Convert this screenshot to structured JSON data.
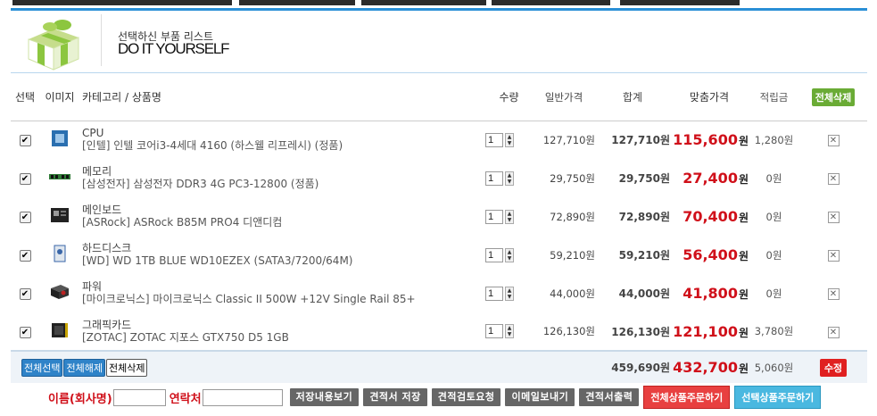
{
  "header": {
    "subtitle": "선택하신 부품 리스트",
    "title": "DO IT YOURSELF"
  },
  "columns": {
    "select": "선택",
    "image": "이미지",
    "category_product": "카테고리 / 상품명",
    "qty": "수량",
    "list_price": "일반가격",
    "sum": "합계",
    "sale_price": "맞춤가격",
    "points": "적립금",
    "delete_all": "전체삭제"
  },
  "currency": "원",
  "items": [
    {
      "checked": true,
      "icon": "cpu-icon",
      "category": "CPU",
      "name": "[인텔] 인텔 코어i3-4세대 4160 (하스웰 리프레시) (정품)",
      "qty": "1",
      "list_price": "127,710원",
      "sum": "127,710원",
      "sale_price": "115,600",
      "points": "1,280원"
    },
    {
      "checked": true,
      "icon": "memory-icon",
      "category": "메모리",
      "name": "[삼성전자] 삼성전자 DDR3 4G PC3-12800 (정품)",
      "qty": "1",
      "list_price": "29,750원",
      "sum": "29,750원",
      "sale_price": "27,400",
      "points": "0원"
    },
    {
      "checked": true,
      "icon": "mainboard-icon",
      "category": "메인보드",
      "name": "[ASRock] ASRock B85M PRO4 디앤디컴",
      "qty": "1",
      "list_price": "72,890원",
      "sum": "72,890원",
      "sale_price": "70,400",
      "points": "0원"
    },
    {
      "checked": true,
      "icon": "hdd-icon",
      "category": "하드디스크",
      "name": "[WD] WD 1TB BLUE WD10EZEX (SATA3/7200/64M)",
      "qty": "1",
      "list_price": "59,210원",
      "sum": "59,210원",
      "sale_price": "56,400",
      "points": "0원"
    },
    {
      "checked": true,
      "icon": "psu-icon",
      "category": "파워",
      "name": "[마이크로닉스] 마이크로닉스 Classic II 500W +12V Single Rail 85+",
      "qty": "1",
      "list_price": "44,000원",
      "sum": "44,000원",
      "sale_price": "41,800",
      "points": "0원"
    },
    {
      "checked": true,
      "icon": "gpu-icon",
      "category": "그래픽카드",
      "name": "[ZOTAC] ZOTAC 지포스 GTX750 D5 1GB",
      "qty": "1",
      "list_price": "126,130원",
      "sum": "126,130원",
      "sale_price": "121,100",
      "points": "3,780원"
    }
  ],
  "footer": {
    "select_all": "전체선택",
    "deselect_all": "전체해제",
    "delete_all": "전체삭제",
    "total_sum": "459,690원",
    "total_sale": "432,700",
    "total_points": "5,060원",
    "modify": "수정"
  },
  "bottom": {
    "name_label": "이름(회사명)",
    "name_value": "",
    "contact_label": "연락처",
    "contact_value": "",
    "btn_view_saved": "저장내용보기",
    "btn_save_quote": "견적서 저장",
    "btn_request_review": "견적검토요청",
    "btn_send_email": "이메일보내기",
    "btn_print_quote": "견적서출력",
    "btn_order_all": "전체상품주문하기",
    "btn_order_selected": "선택상품주문하기"
  },
  "colors": {
    "accent": "#2a8fd6",
    "sale": "#d0101a",
    "green": "#6aab35",
    "order_red": "#e84040",
    "order_blue": "#4ab8e0"
  }
}
